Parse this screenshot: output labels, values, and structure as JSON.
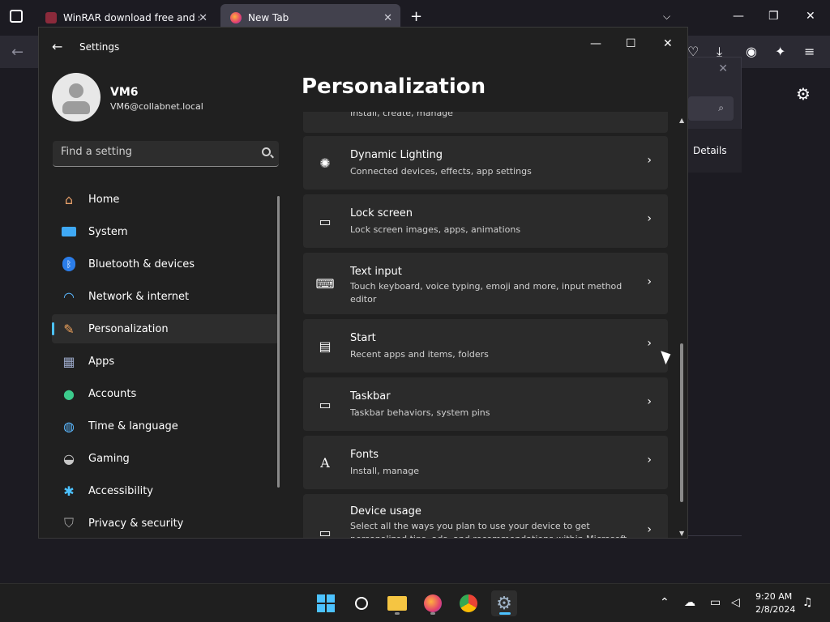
{
  "browser": {
    "tabs": [
      {
        "label": "WinRAR download free and support",
        "close": "✕"
      },
      {
        "label": "New Tab",
        "close": "✕"
      }
    ],
    "new_tab": "+",
    "dropdown": "⌵",
    "min": "—",
    "restore": "❐",
    "close": "✕",
    "back": "←",
    "bg_dialog": {
      "close": "✕",
      "search_glyph": "⌕",
      "details_label": "Details"
    }
  },
  "settings": {
    "title": "Settings",
    "back": "←",
    "min": "—",
    "max": "☐",
    "close": "✕",
    "profile": {
      "name": "VM6",
      "email": "VM6@collabnet.local"
    },
    "search": {
      "placeholder": "Find a setting"
    },
    "nav": [
      {
        "label": "Home",
        "icon": "home-icon"
      },
      {
        "label": "System",
        "icon": "system-icon"
      },
      {
        "label": "Bluetooth & devices",
        "icon": "bluetooth-icon"
      },
      {
        "label": "Network & internet",
        "icon": "wifi-icon"
      },
      {
        "label": "Personalization",
        "icon": "brush-icon",
        "selected": true
      },
      {
        "label": "Apps",
        "icon": "apps-icon"
      },
      {
        "label": "Accounts",
        "icon": "accounts-icon"
      },
      {
        "label": "Time & language",
        "icon": "globe-icon"
      },
      {
        "label": "Gaming",
        "icon": "gamepad-icon"
      },
      {
        "label": "Accessibility",
        "icon": "accessibility-icon"
      },
      {
        "label": "Privacy & security",
        "icon": "shield-icon"
      }
    ],
    "page_title": "Personalization",
    "cards": [
      {
        "title": "",
        "desc": "Install, create, manage",
        "icon": "partial-icon"
      },
      {
        "title": "Dynamic Lighting",
        "desc": "Connected devices, effects, app settings",
        "icon": "lighting-icon"
      },
      {
        "title": "Lock screen",
        "desc": "Lock screen images, apps, animations",
        "icon": "lock-screen-icon"
      },
      {
        "title": "Text input",
        "desc": "Touch keyboard, voice typing, emoji and more, input method editor",
        "icon": "keyboard-icon"
      },
      {
        "title": "Start",
        "desc": "Recent apps and items, folders",
        "icon": "start-icon"
      },
      {
        "title": "Taskbar",
        "desc": "Taskbar behaviors, system pins",
        "icon": "taskbar-icon"
      },
      {
        "title": "Fonts",
        "desc": "Install, manage",
        "icon": "fonts-icon"
      },
      {
        "title": "Device usage",
        "desc": "Select all the ways you plan to use your device to get personalized tips, ads, and recommendations within Microsoft",
        "icon": "device-usage-icon"
      }
    ],
    "chevron": "›"
  },
  "taskbar": {
    "clock_time": "9:20 AM",
    "clock_date": "2/8/2024"
  },
  "colors": {
    "accent": "#4cc2ff",
    "card": "#2b2b2b",
    "window": "#202020"
  }
}
